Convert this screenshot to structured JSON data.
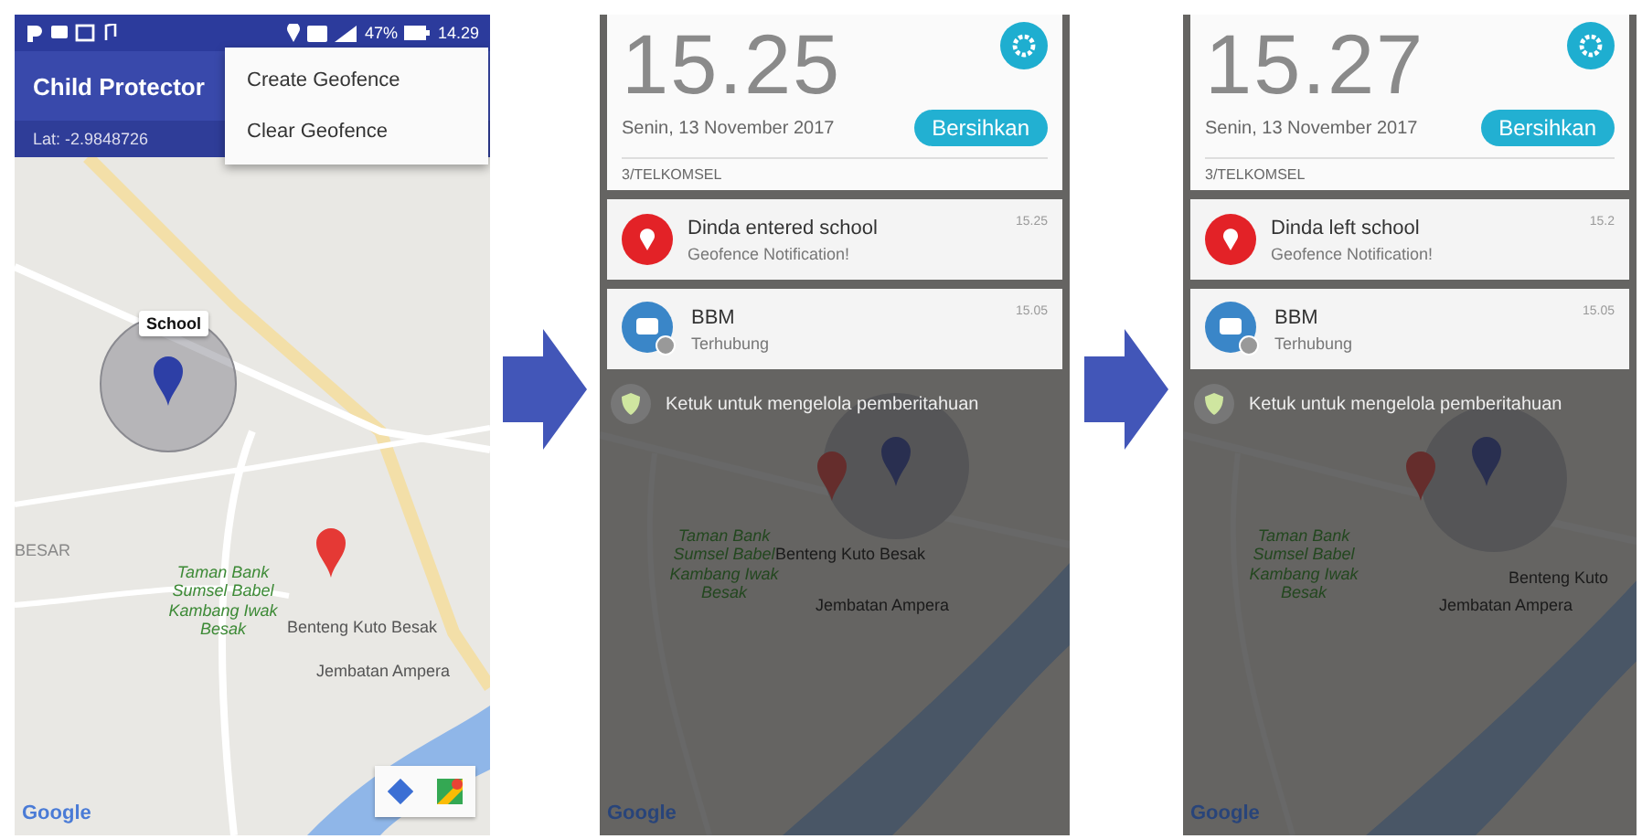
{
  "screens": [
    {
      "kind": "app",
      "status_bar": {
        "battery": "47%",
        "time": "14.29"
      },
      "app_bar": {
        "title": "Child Protector"
      },
      "menu": [
        {
          "label": "Create Geofence"
        },
        {
          "label": "Clear Geofence"
        }
      ],
      "location_bar": {
        "text": "Lat: -2.9848726"
      },
      "map": {
        "labels": [
          {
            "kind": "pin",
            "text": "School"
          },
          {
            "kind": "area",
            "text": "BESAR"
          },
          {
            "kind": "park",
            "text": "Taman Bank Sumsel Babel Kambang Iwak Besak"
          },
          {
            "kind": "place",
            "text": "Benteng Kuto Besak"
          },
          {
            "kind": "place",
            "text": "Jembatan Ampera"
          }
        ],
        "logo": "Google"
      }
    },
    {
      "kind": "notifications",
      "shade": {
        "time": "15.25",
        "date": "Senin, 13 November 2017",
        "clear_button": "Bersihkan",
        "carrier": "3/TELKOMSEL"
      },
      "notifications": [
        {
          "kind": "geofence",
          "title": "Dinda entered school",
          "text": "Geofence Notification!",
          "time": "15.25"
        },
        {
          "kind": "message",
          "title": "BBM",
          "text": "Terhubung",
          "time": "15.05"
        }
      ],
      "manage_hint": "Ketuk untuk mengelola pemberitahuan",
      "map": {
        "labels": [
          {
            "kind": "park",
            "text": "Taman Bank Sumsel Babel Kambang Iwak Besak"
          },
          {
            "kind": "place",
            "text": "Benteng Kuto Besak"
          },
          {
            "kind": "place",
            "text": "Jembatan Ampera"
          }
        ],
        "logo": "Google"
      }
    },
    {
      "kind": "notifications",
      "shade": {
        "time": "15.27",
        "date": "Senin, 13 November 2017",
        "clear_button": "Bersihkan",
        "carrier": "3/TELKOMSEL"
      },
      "notifications": [
        {
          "kind": "geofence",
          "title": "Dinda left school",
          "text": "Geofence Notification!",
          "time": "15.2"
        },
        {
          "kind": "message",
          "title": "BBM",
          "text": "Terhubung",
          "time": "15.05"
        }
      ],
      "manage_hint": "Ketuk untuk mengelola pemberitahuan",
      "map": {
        "labels": [
          {
            "kind": "park",
            "text": "Taman Bank Sumsel Babel Kambang Iwak Besak"
          },
          {
            "kind": "place",
            "text": "Benteng Kuto"
          },
          {
            "kind": "place",
            "text": "Jembatan Ampera"
          }
        ],
        "logo": "Google"
      }
    }
  ]
}
